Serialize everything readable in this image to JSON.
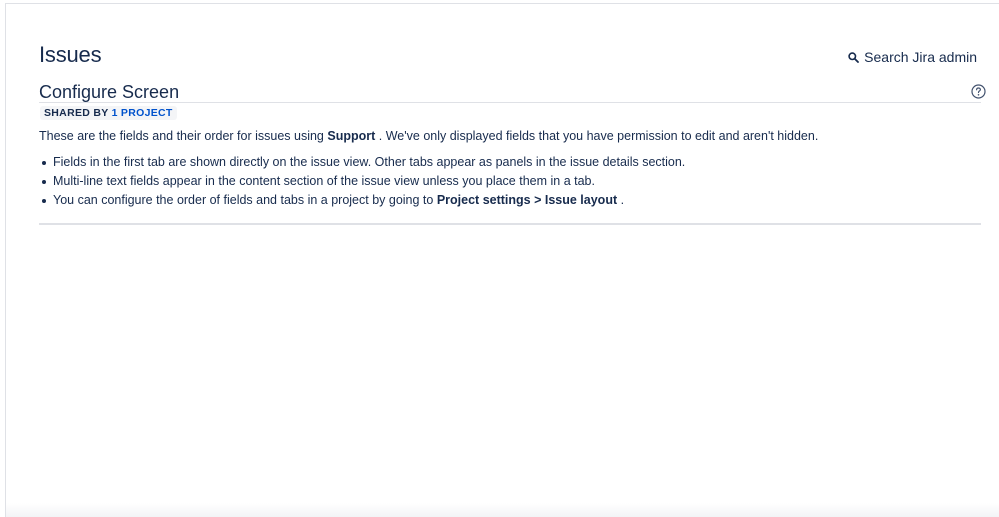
{
  "page": {
    "title": "Issues",
    "search_admin_label": "Search Jira admin"
  },
  "screen": {
    "title": "Configure Screen",
    "shared_prefix": "SHARED BY",
    "shared_link": "1 PROJECT"
  },
  "intro": {
    "before": "These are the fields and their order for issues using",
    "issue_type": "Support",
    "after": ". We've only displayed fields that you have permission to edit and aren't hidden."
  },
  "notes": [
    {
      "text": "Fields in the first tab are shown directly on the issue view. Other tabs appear as panels in the issue details section."
    },
    {
      "text": "Multi-line text fields appear in the content section of the issue view unless you place them in a tab."
    },
    {
      "before": "You can configure the order of fields and tabs in a project by going to",
      "bold": "Project settings > Issue layout",
      "after": "."
    }
  ],
  "icons": {
    "search": "search-icon",
    "help": "help-icon"
  },
  "colors": {
    "text": "#172b4d",
    "link": "#0052cc",
    "border": "#dfe1e6",
    "badge_bg": "#f4f5f7"
  }
}
